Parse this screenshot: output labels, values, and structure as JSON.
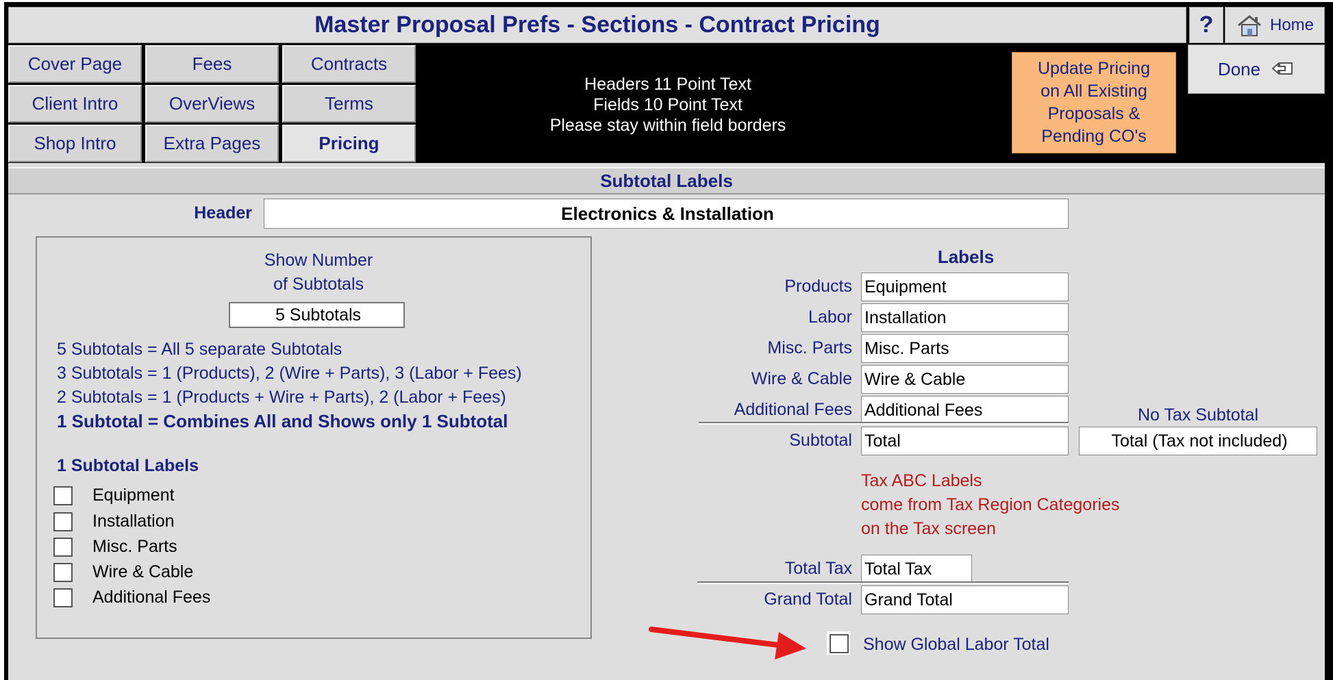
{
  "title": "Master Proposal Prefs - Sections - Contract Pricing",
  "help_label": "?",
  "home_label": "Home",
  "tabs": [
    {
      "label": "Cover Page"
    },
    {
      "label": "Fees"
    },
    {
      "label": "Contracts"
    },
    {
      "label": "Client Intro"
    },
    {
      "label": "OverViews"
    },
    {
      "label": "Terms"
    },
    {
      "label": "Shop Intro"
    },
    {
      "label": "Extra Pages"
    },
    {
      "label": "Pricing"
    }
  ],
  "info_lines": [
    "Headers 11 Point Text",
    "Fields 10 Point Text",
    "Please stay within field borders"
  ],
  "update_button": "Update Pricing\non All Existing\nProposals &\nPending CO's",
  "done_label": "Done",
  "section_title": "Subtotal Labels",
  "header": {
    "label": "Header",
    "value": "Electronics & Installation"
  },
  "show_number": {
    "label_1": "Show Number",
    "label_2": "of Subtotals",
    "value": "5 Subtotals"
  },
  "descriptions": [
    "5  Subtotals = All 5 separate Subtotals",
    "3  Subtotals = 1 (Products),  2 (Wire + Parts),  3 (Labor + Fees)",
    "2  Subtotals = 1 (Products + Wire + Parts),  2 (Labor + Fees)",
    "1  Subtotal   = Combines All and Shows only 1 Subtotal"
  ],
  "one_subtotal": {
    "heading": "1 Subtotal Labels",
    "items": [
      {
        "label": "Equipment",
        "checked": false
      },
      {
        "label": "Installation",
        "checked": false
      },
      {
        "label": "Misc. Parts",
        "checked": false
      },
      {
        "label": "Wire & Cable",
        "checked": false
      },
      {
        "label": "Additional Fees",
        "checked": false
      }
    ]
  },
  "labels": {
    "heading": "Labels",
    "rows": [
      {
        "label": "Products",
        "value": "Equipment"
      },
      {
        "label": "Labor",
        "value": "Installation"
      },
      {
        "label": "Misc. Parts",
        "value": "Misc. Parts"
      },
      {
        "label": "Wire & Cable",
        "value": "Wire & Cable"
      },
      {
        "label": "Additional Fees",
        "value": "Additional Fees"
      }
    ],
    "subtotal": {
      "label": "Subtotal",
      "value": "Total"
    },
    "no_tax": {
      "label": "No Tax Subtotal",
      "value": "Total (Tax not included)"
    },
    "tax_note": [
      "Tax ABC Labels",
      "come from Tax Region Categories",
      "on the Tax screen"
    ],
    "total_tax": {
      "label": "Total Tax",
      "value": "Total Tax"
    },
    "grand_total": {
      "label": "Grand Total",
      "value": "Grand Total"
    }
  },
  "global_labor": {
    "label": "Show Global Labor Total",
    "checked": false
  },
  "colors": {
    "accent": "#1a237e",
    "note_red": "#b71c1c",
    "arrow_red": "#e51c1c",
    "update_bg": "#f9b97c"
  }
}
